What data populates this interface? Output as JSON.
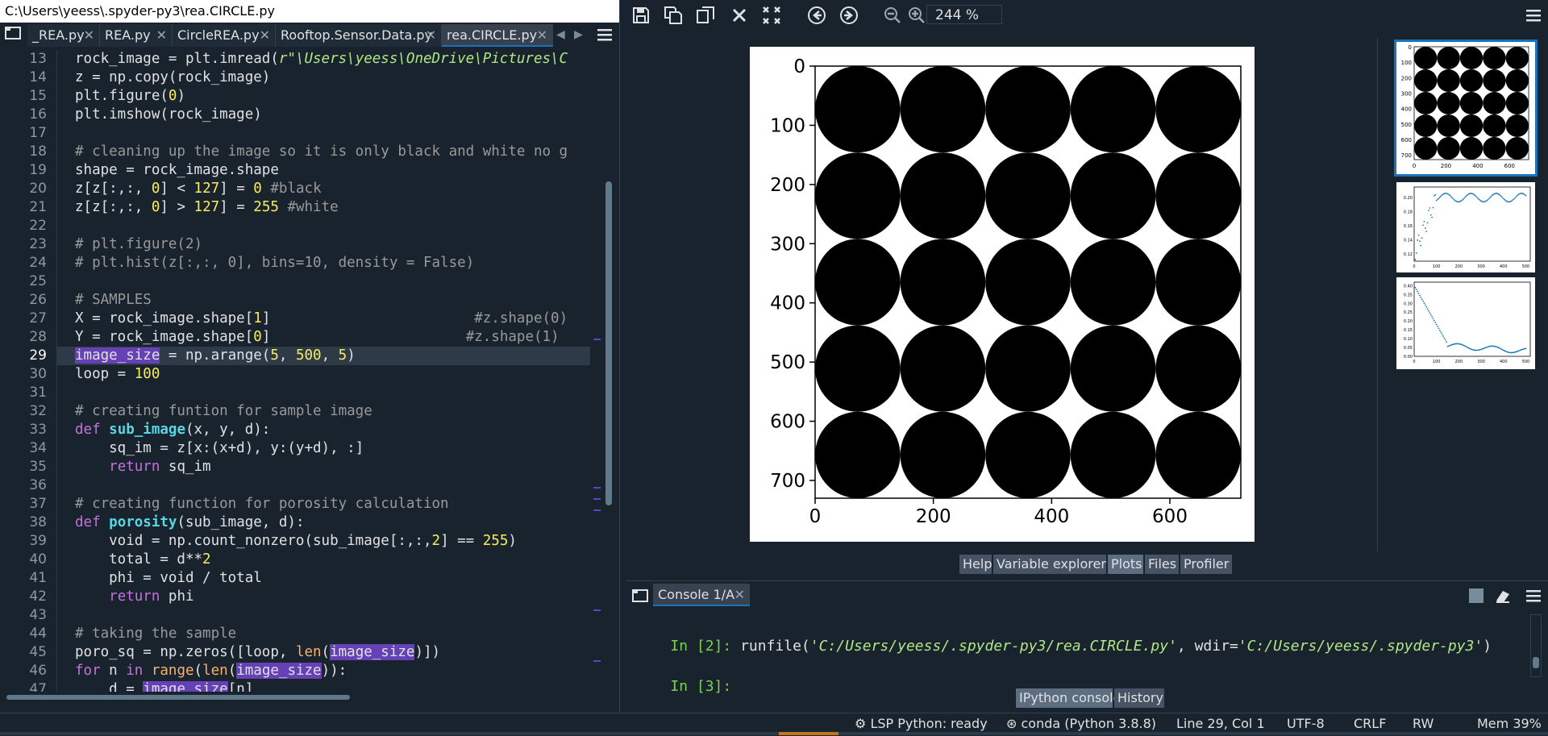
{
  "window": {
    "file_path": "C:\\Users\\yeess\\.spyder-py3\\rea.CIRCLE.py"
  },
  "editor": {
    "tabs": [
      {
        "label": "_REA.py",
        "active": false
      },
      {
        "label": "REA.py",
        "active": false
      },
      {
        "label": "CircleREA.py",
        "active": false
      },
      {
        "label": "Rooftop.Sensor.Data.py",
        "active": false
      },
      {
        "label": "rea.CIRCLE.py",
        "active": true
      }
    ],
    "tab_close_glyph": "✕",
    "current_line": 29,
    "line_numbers": [
      "13",
      "14",
      "15",
      "16",
      "17",
      "18",
      "19",
      "20",
      "21",
      "22",
      "23",
      "24",
      "25",
      "26",
      "27",
      "28",
      "29",
      "30",
      "31",
      "32",
      "33",
      "34",
      "35",
      "36",
      "37",
      "38",
      "39",
      "40",
      "41",
      "42",
      "43",
      "44",
      "45",
      "46",
      "47"
    ]
  },
  "plots_toolbar": {
    "icons": [
      "save-icon",
      "save-all-icon",
      "copy-icon",
      "close-icon",
      "close-all-icon",
      "previous-icon",
      "next-icon",
      "zoom-out-icon",
      "zoom-in-icon"
    ],
    "zoom": "244 %"
  },
  "plot_main": {
    "x_ticks": [
      "0",
      "200",
      "400",
      "600"
    ],
    "y_ticks": [
      "0",
      "100",
      "200",
      "300",
      "400",
      "500",
      "600",
      "700"
    ],
    "grid_rows": 5,
    "grid_cols": 5
  },
  "plot_thumbs": {
    "thumb1": {
      "x_ticks": [
        "0",
        "200",
        "400",
        "600"
      ],
      "y_ticks": [
        "0",
        "100",
        "200",
        "300",
        "400",
        "500",
        "600",
        "700"
      ]
    },
    "thumb2": {
      "y_ticks": [
        "0.20",
        "0.18",
        "0.16",
        "0.14",
        "0.12"
      ],
      "x_ticks": [
        "0",
        "100",
        "200",
        "300",
        "400",
        "500"
      ]
    },
    "thumb3": {
      "y_ticks": [
        "0.40",
        "0.35",
        "0.30",
        "0.25",
        "0.20",
        "0.15",
        "0.10",
        "0.05",
        "0.00"
      ],
      "x_ticks": [
        "0",
        "100",
        "200",
        "300",
        "400",
        "500"
      ]
    }
  },
  "plots_pane_tabs": [
    {
      "label": "Help",
      "active": false
    },
    {
      "label": "Variable explorer",
      "active": false
    },
    {
      "label": "Plots",
      "active": true
    },
    {
      "label": "Files",
      "active": false
    },
    {
      "label": "Profiler",
      "active": false
    }
  ],
  "console": {
    "tab_label": "Console 1/A",
    "line1_prompt": "In [2]:",
    "line1_cmd": "runfile(",
    "line1_arg1": "'C:/Users/yeess/.spyder-py3/rea.CIRCLE.py'",
    "line1_mid": ", wdir=",
    "line1_arg2": "'C:/Users/yeess/.spyder-py3'",
    "line1_end": ")",
    "line2_prompt": "In [3]:"
  },
  "console_pane_tabs": [
    {
      "label": "IPython console",
      "active": true
    },
    {
      "label": "History",
      "active": false
    }
  ],
  "status": {
    "lsp": "LSP Python: ready",
    "env": "conda (Python 3.8.8)",
    "position": "Line 29, Col 1",
    "encoding": "UTF-8",
    "eol": "CRLF",
    "perms": "RW",
    "mem": "Mem 39%"
  }
}
